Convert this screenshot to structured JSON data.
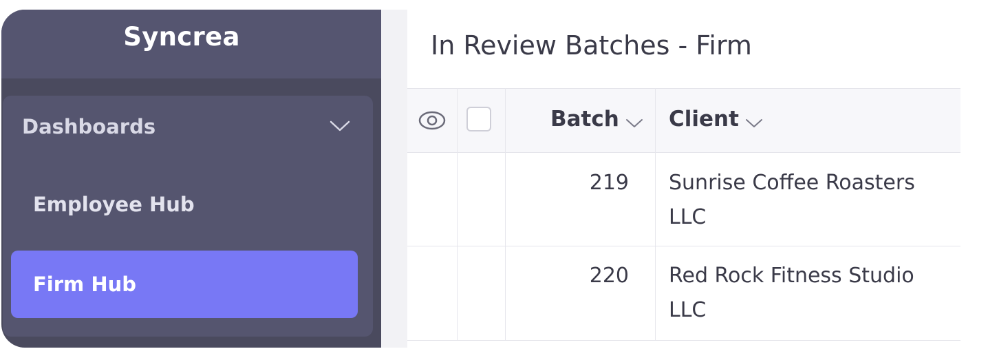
{
  "sidebar": {
    "brand": "Syncrea",
    "section": {
      "label": "Dashboards",
      "icon": "chevron-down-icon"
    },
    "items": [
      {
        "label": "Employee Hub",
        "active": false
      },
      {
        "label": "Firm Hub",
        "active": true
      }
    ],
    "colors": {
      "background": "#4a4a5e",
      "active": "#7878f5"
    }
  },
  "main": {
    "title": "In Review Batches - Firm",
    "table": {
      "columns": [
        {
          "label": "",
          "icon": "eye-icon"
        },
        {
          "label": "",
          "icon": "checkbox"
        },
        {
          "label": "Batch",
          "icon": "chevron-down-icon"
        },
        {
          "label": "Client",
          "icon": "chevron-down-icon"
        }
      ],
      "rows": [
        {
          "batch": "219",
          "client_line1": "Sunrise Coffee Roasters",
          "client_line2": "LLC"
        },
        {
          "batch": "220",
          "client_line1": "Red Rock Fitness Studio",
          "client_line2": "LLC"
        }
      ]
    }
  }
}
